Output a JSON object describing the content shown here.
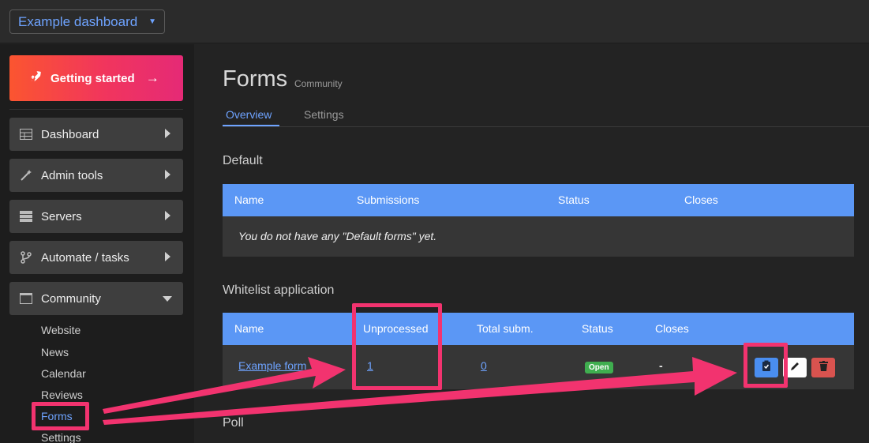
{
  "topbar": {
    "dashboard_select": "Example dashboard"
  },
  "sidebar": {
    "getting_started": "Getting started",
    "items": [
      {
        "label": "Dashboard",
        "icon": "table-icon"
      },
      {
        "label": "Admin tools",
        "icon": "magic-wand-icon"
      },
      {
        "label": "Servers",
        "icon": "server-icon"
      },
      {
        "label": "Automate / tasks",
        "icon": "branch-icon"
      },
      {
        "label": "Community",
        "icon": "window-icon"
      }
    ],
    "community_sub": [
      "Website",
      "News",
      "Calendar",
      "Reviews",
      "Forms",
      "Settings"
    ]
  },
  "main": {
    "title": "Forms",
    "subtitle": "Community",
    "tabs": [
      "Overview",
      "Settings"
    ],
    "default_section": {
      "title": "Default",
      "columns": [
        "Name",
        "Submissions",
        "Status",
        "Closes"
      ],
      "empty_message": "You do not have any \"Default forms\" yet."
    },
    "whitelist_section": {
      "title": "Whitelist application",
      "columns": [
        "Name",
        "Unprocessed",
        "Total subm.",
        "Status",
        "Closes"
      ],
      "row": {
        "name": "Example form",
        "unprocessed": "1",
        "total": "0",
        "status": "Open",
        "closes": "-"
      }
    },
    "poll_section": {
      "title": "Poll"
    }
  },
  "colors": {
    "accent": "#5b97f5",
    "link": "#6ea3ff",
    "annotation": "#f2336f",
    "open_badge": "#3fae4f",
    "delete_button": "#d9534f"
  }
}
